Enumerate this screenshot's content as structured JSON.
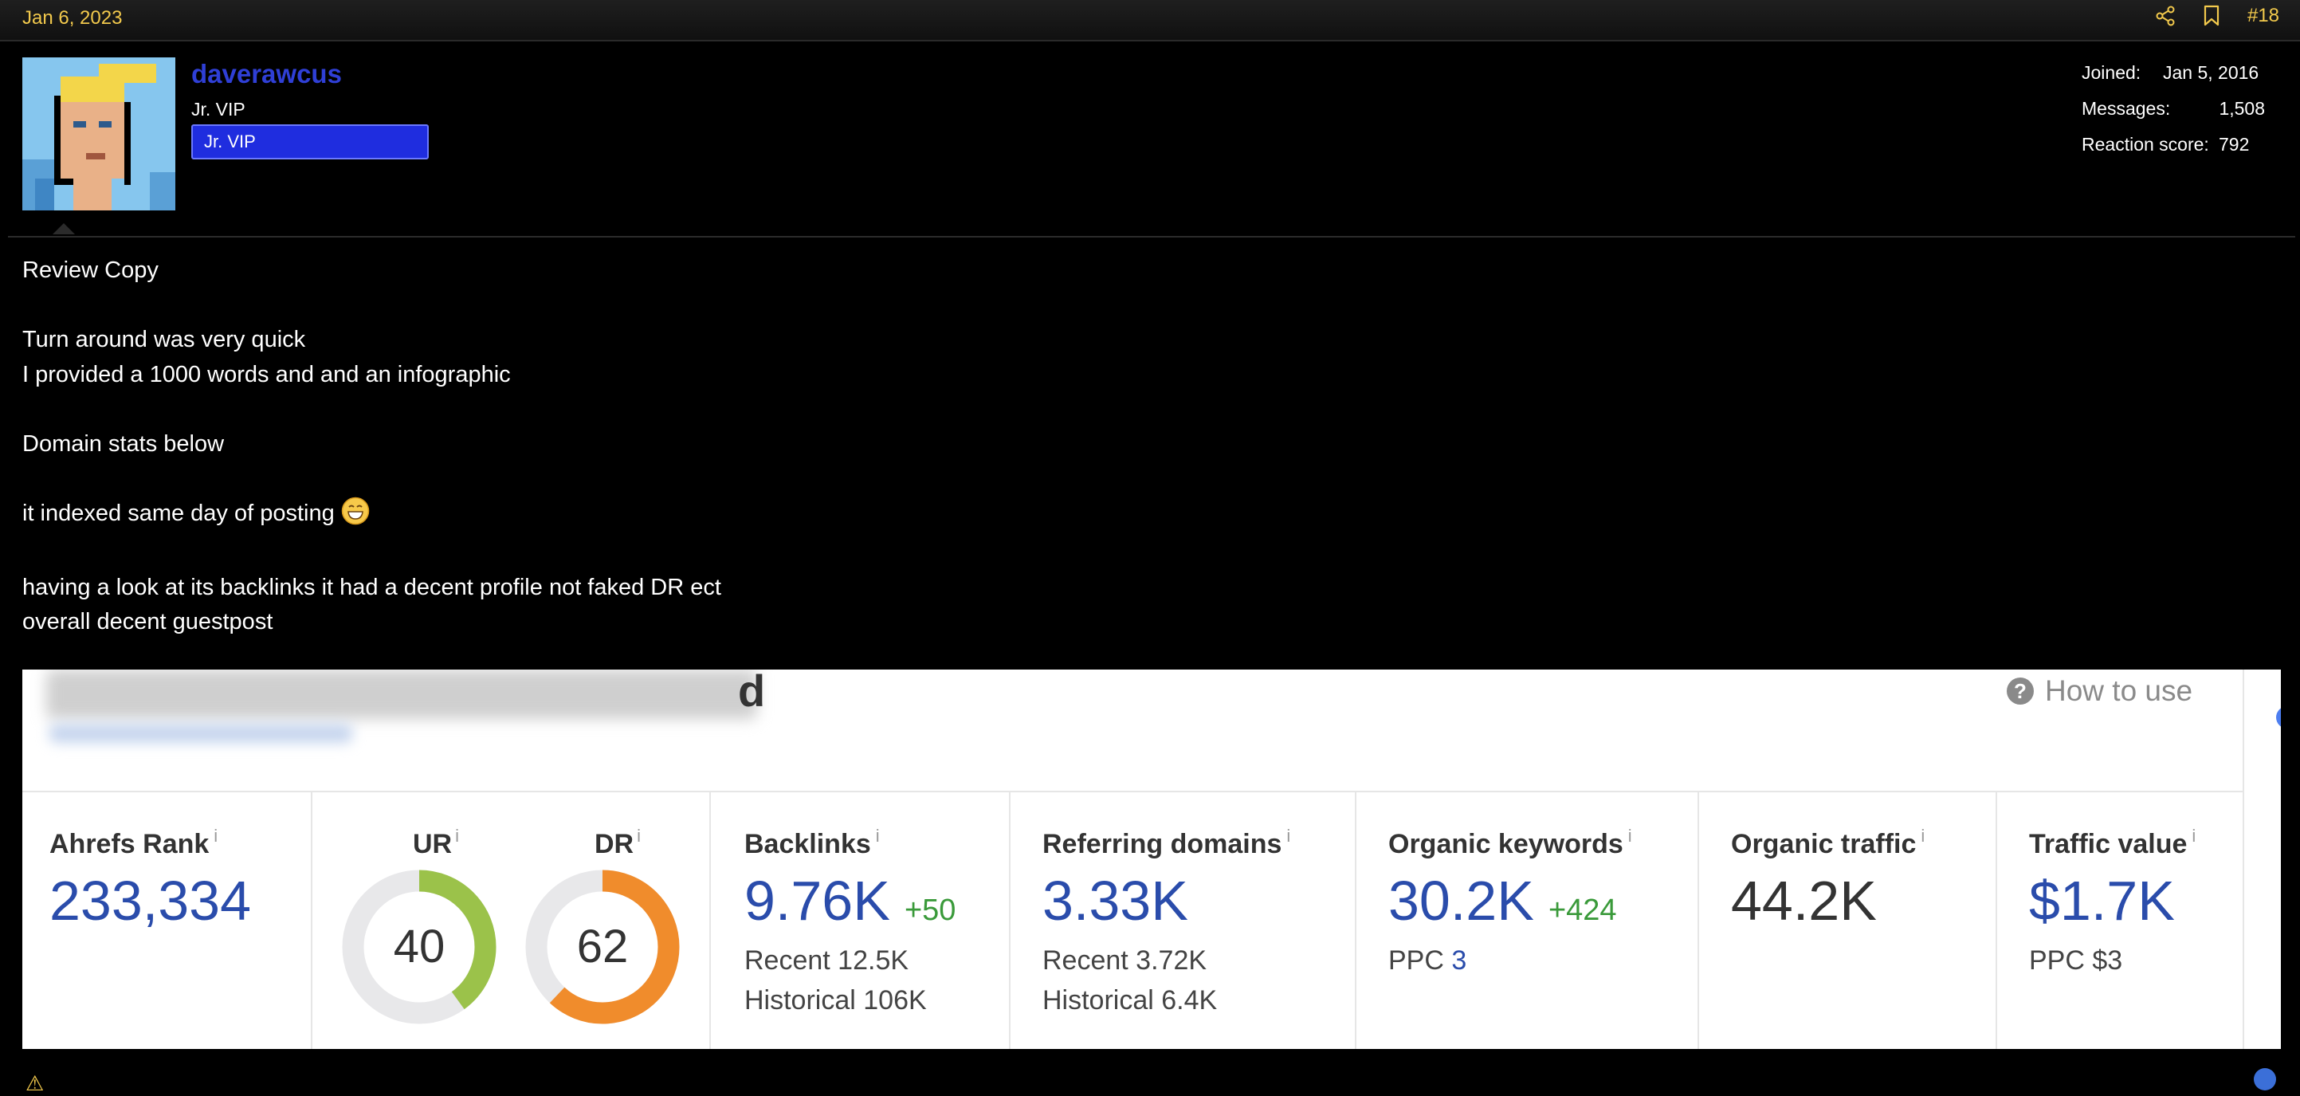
{
  "post": {
    "date": "Jan 6, 2023",
    "number": "#18",
    "share_icon": "share-icon",
    "bookmark_icon": "bookmark-icon"
  },
  "user": {
    "name": "daverawcus",
    "title": "Jr. VIP",
    "banner": "Jr. VIP",
    "stats": {
      "joined_label": "Joined:",
      "joined_value": "Jan 5, 2016",
      "messages_label": "Messages:",
      "messages_value": "1,508",
      "reaction_label": "Reaction score:",
      "reaction_value": "792"
    }
  },
  "body": {
    "lines": [
      "Review Copy",
      "",
      "Turn around was very quick",
      "I provided a 1000 words and and an infographic",
      "",
      "Domain stats below",
      "",
      "it indexed same day of posting",
      "",
      "having a look at its backlinks it had a decent profile not faked DR ect",
      "overall decent guestpost"
    ]
  },
  "ahrefs": {
    "title_tail": "d",
    "how_to_use": "How to use",
    "info_mark": "i",
    "metrics": {
      "ahrefs_rank": {
        "label": "Ahrefs Rank",
        "value": "233,334"
      },
      "ur": {
        "label": "UR",
        "value": "40",
        "fraction": 0.4
      },
      "dr": {
        "label": "DR",
        "value": "62",
        "fraction": 0.62
      },
      "backlinks": {
        "label": "Backlinks",
        "value": "9.76K",
        "delta": "+50",
        "recent": "Recent 12.5K",
        "historical": "Historical 106K"
      },
      "referring_domains": {
        "label": "Referring domains",
        "value": "3.33K",
        "recent": "Recent 3.72K",
        "historical": "Historical 6.4K"
      },
      "organic_keywords": {
        "label": "Organic keywords",
        "value": "30.2K",
        "delta": "+424",
        "ppc_label": "PPC",
        "ppc_value": "3"
      },
      "organic_traffic": {
        "label": "Organic traffic",
        "value": "44.2K"
      },
      "traffic_value": {
        "label": "Traffic value",
        "value": "$1.7K",
        "ppc": "PPC $3"
      }
    }
  },
  "colors": {
    "accent_gold": "#f2c94c",
    "username_blue": "#2f3fd6",
    "metric_blue": "#2a4cab",
    "ur_green": "#9bc24a",
    "dr_orange": "#f08c2c",
    "gauge_track": "#e8e8ea"
  }
}
